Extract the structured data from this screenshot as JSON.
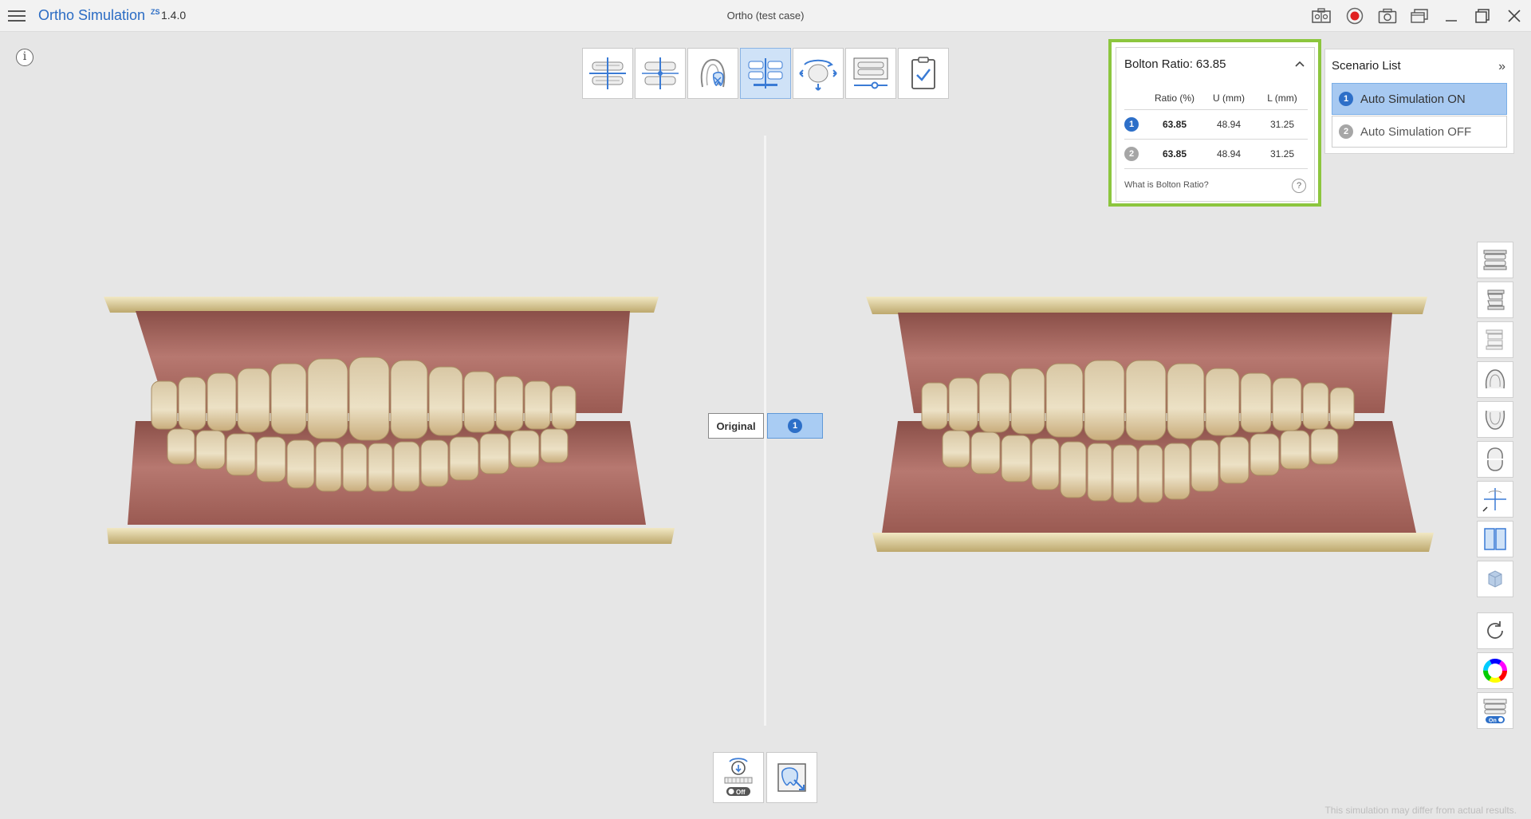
{
  "app": {
    "title": "Ortho Simulation",
    "badge": "ZS",
    "version": "1.4.0",
    "window_title": "Ortho (test case)"
  },
  "titlebar_icons": [
    "capture-compare-icon",
    "record-icon",
    "camera-icon",
    "window-overlay-icon",
    "minimize-icon",
    "maximize-icon",
    "close-icon"
  ],
  "info_label": "i",
  "toolbar": {
    "tools": [
      "bite-alignment-icon",
      "midline-icon",
      "tooth-exclusion-icon",
      "bolton-compare-icon",
      "rotation-adjust-icon",
      "ipr-slider-icon",
      "confirm-checklist-icon"
    ],
    "active_index": 3
  },
  "views": {
    "original_label": "Original",
    "scenario_label": "1"
  },
  "bolton": {
    "title": "Bolton Ratio:",
    "ratio": "63.85",
    "columns": [
      "Ratio (%)",
      "U (mm)",
      "L (mm)"
    ],
    "rows": [
      {
        "num": "1",
        "ratio": "63.85",
        "upper": "48.94",
        "lower": "31.25"
      },
      {
        "num": "2",
        "ratio": "63.85",
        "upper": "48.94",
        "lower": "31.25"
      }
    ],
    "help_text": "What is Bolton Ratio?",
    "help_icon": "?"
  },
  "scenario": {
    "title": "Scenario List",
    "expand": "»",
    "items": [
      {
        "num": "1",
        "label": "Auto Simulation ON",
        "selected": true
      },
      {
        "num": "2",
        "label": "Auto Simulation OFF",
        "selected": false
      }
    ]
  },
  "side_tools": [
    "front-view-icon",
    "left-view-icon",
    "right-view-icon",
    "upper-arch-icon",
    "lower-arch-icon",
    "occlusal-view-icon",
    "axis-view-icon",
    "split-view-icon",
    "cube-view-icon",
    "reset-rotation-icon",
    "color-wheel-icon",
    "toggle-on-icon"
  ],
  "side_toggle_label": "On",
  "bottom_tools": [
    "motion-off-icon",
    "tooth-select-icon"
  ],
  "bottom_toggle_label": "Off",
  "disclaimer": "This simulation may differ from actual results.",
  "colors": {
    "accent": "#2b6cc4",
    "highlight": "#8cc63e",
    "active_tool": "#cfe2f7",
    "selected_item": "#a7c9f1",
    "gum": "#b06e66",
    "tooth": "#e3d2b0",
    "base": "#e8dcae"
  }
}
